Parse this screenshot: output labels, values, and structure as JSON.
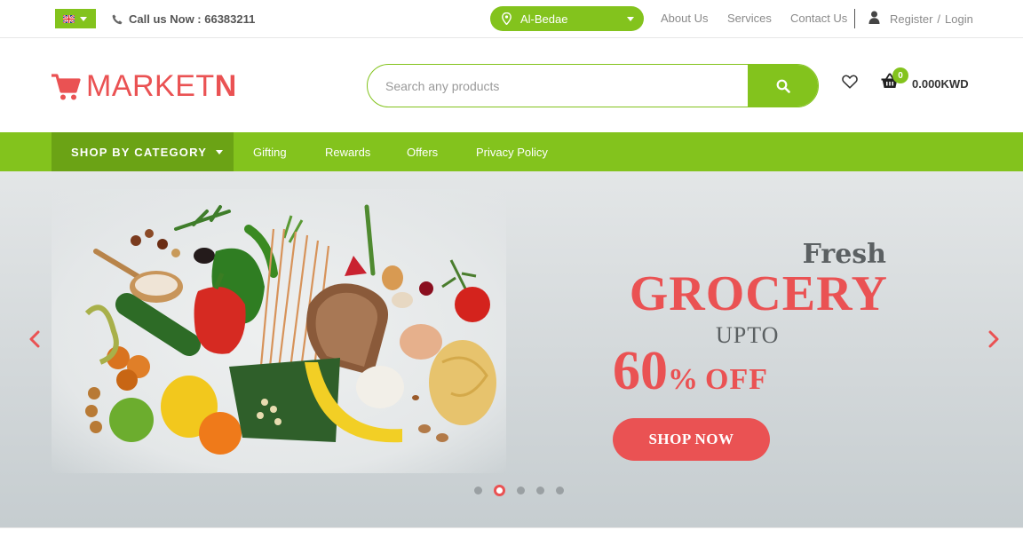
{
  "topbar": {
    "phone_text": "Call us Now : 66383211",
    "location": "Al-Bedae",
    "nav": [
      {
        "label": "About Us"
      },
      {
        "label": "Services"
      },
      {
        "label": "Contact Us"
      }
    ],
    "register_label": "Register",
    "separator": "/",
    "login_label": "Login"
  },
  "header": {
    "logo_text_main": "MARKET",
    "logo_text_accent": "N",
    "search_placeholder": "Search any products",
    "cart_count": "0",
    "cart_total": "0.000KWD"
  },
  "navbar": {
    "category_label": "SHOP BY CATEGORY",
    "links": [
      {
        "label": "Gifting"
      },
      {
        "label": "Rewards"
      },
      {
        "label": "Offers"
      },
      {
        "label": "Privacy Policy"
      }
    ]
  },
  "banner": {
    "line1": "Fresh",
    "line2": "GROCERY",
    "line3": "UPTO",
    "discount_number": "60",
    "discount_percent": "%",
    "discount_off": "OFF",
    "cta_label": "SHOP NOW",
    "slide_count": 5,
    "active_slide": 2
  },
  "colors": {
    "brand_green": "#83c31d",
    "brand_green_dark": "#6ba315",
    "accent_red": "#ea5253"
  },
  "icons": [
    "uk-flag-icon",
    "phone-icon",
    "location-pin-icon",
    "user-icon",
    "cart-logo-icon",
    "search-icon",
    "heart-icon",
    "basket-icon",
    "chevron-left-icon",
    "chevron-right-icon"
  ]
}
